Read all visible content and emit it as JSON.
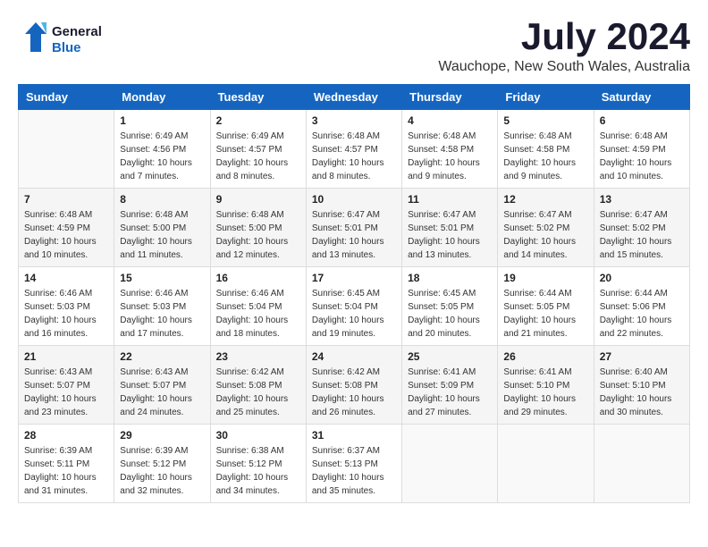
{
  "header": {
    "logo_general": "General",
    "logo_blue": "Blue",
    "month_title": "July 2024",
    "location": "Wauchope, New South Wales, Australia"
  },
  "calendar": {
    "days_of_week": [
      "Sunday",
      "Monday",
      "Tuesday",
      "Wednesday",
      "Thursday",
      "Friday",
      "Saturday"
    ],
    "weeks": [
      [
        {
          "day": "",
          "info": ""
        },
        {
          "day": "1",
          "info": "Sunrise: 6:49 AM\nSunset: 4:56 PM\nDaylight: 10 hours\nand 7 minutes."
        },
        {
          "day": "2",
          "info": "Sunrise: 6:49 AM\nSunset: 4:57 PM\nDaylight: 10 hours\nand 8 minutes."
        },
        {
          "day": "3",
          "info": "Sunrise: 6:48 AM\nSunset: 4:57 PM\nDaylight: 10 hours\nand 8 minutes."
        },
        {
          "day": "4",
          "info": "Sunrise: 6:48 AM\nSunset: 4:58 PM\nDaylight: 10 hours\nand 9 minutes."
        },
        {
          "day": "5",
          "info": "Sunrise: 6:48 AM\nSunset: 4:58 PM\nDaylight: 10 hours\nand 9 minutes."
        },
        {
          "day": "6",
          "info": "Sunrise: 6:48 AM\nSunset: 4:59 PM\nDaylight: 10 hours\nand 10 minutes."
        }
      ],
      [
        {
          "day": "7",
          "info": "Sunrise: 6:48 AM\nSunset: 4:59 PM\nDaylight: 10 hours\nand 10 minutes."
        },
        {
          "day": "8",
          "info": "Sunrise: 6:48 AM\nSunset: 5:00 PM\nDaylight: 10 hours\nand 11 minutes."
        },
        {
          "day": "9",
          "info": "Sunrise: 6:48 AM\nSunset: 5:00 PM\nDaylight: 10 hours\nand 12 minutes."
        },
        {
          "day": "10",
          "info": "Sunrise: 6:47 AM\nSunset: 5:01 PM\nDaylight: 10 hours\nand 13 minutes."
        },
        {
          "day": "11",
          "info": "Sunrise: 6:47 AM\nSunset: 5:01 PM\nDaylight: 10 hours\nand 13 minutes."
        },
        {
          "day": "12",
          "info": "Sunrise: 6:47 AM\nSunset: 5:02 PM\nDaylight: 10 hours\nand 14 minutes."
        },
        {
          "day": "13",
          "info": "Sunrise: 6:47 AM\nSunset: 5:02 PM\nDaylight: 10 hours\nand 15 minutes."
        }
      ],
      [
        {
          "day": "14",
          "info": "Sunrise: 6:46 AM\nSunset: 5:03 PM\nDaylight: 10 hours\nand 16 minutes."
        },
        {
          "day": "15",
          "info": "Sunrise: 6:46 AM\nSunset: 5:03 PM\nDaylight: 10 hours\nand 17 minutes."
        },
        {
          "day": "16",
          "info": "Sunrise: 6:46 AM\nSunset: 5:04 PM\nDaylight: 10 hours\nand 18 minutes."
        },
        {
          "day": "17",
          "info": "Sunrise: 6:45 AM\nSunset: 5:04 PM\nDaylight: 10 hours\nand 19 minutes."
        },
        {
          "day": "18",
          "info": "Sunrise: 6:45 AM\nSunset: 5:05 PM\nDaylight: 10 hours\nand 20 minutes."
        },
        {
          "day": "19",
          "info": "Sunrise: 6:44 AM\nSunset: 5:05 PM\nDaylight: 10 hours\nand 21 minutes."
        },
        {
          "day": "20",
          "info": "Sunrise: 6:44 AM\nSunset: 5:06 PM\nDaylight: 10 hours\nand 22 minutes."
        }
      ],
      [
        {
          "day": "21",
          "info": "Sunrise: 6:43 AM\nSunset: 5:07 PM\nDaylight: 10 hours\nand 23 minutes."
        },
        {
          "day": "22",
          "info": "Sunrise: 6:43 AM\nSunset: 5:07 PM\nDaylight: 10 hours\nand 24 minutes."
        },
        {
          "day": "23",
          "info": "Sunrise: 6:42 AM\nSunset: 5:08 PM\nDaylight: 10 hours\nand 25 minutes."
        },
        {
          "day": "24",
          "info": "Sunrise: 6:42 AM\nSunset: 5:08 PM\nDaylight: 10 hours\nand 26 minutes."
        },
        {
          "day": "25",
          "info": "Sunrise: 6:41 AM\nSunset: 5:09 PM\nDaylight: 10 hours\nand 27 minutes."
        },
        {
          "day": "26",
          "info": "Sunrise: 6:41 AM\nSunset: 5:10 PM\nDaylight: 10 hours\nand 29 minutes."
        },
        {
          "day": "27",
          "info": "Sunrise: 6:40 AM\nSunset: 5:10 PM\nDaylight: 10 hours\nand 30 minutes."
        }
      ],
      [
        {
          "day": "28",
          "info": "Sunrise: 6:39 AM\nSunset: 5:11 PM\nDaylight: 10 hours\nand 31 minutes."
        },
        {
          "day": "29",
          "info": "Sunrise: 6:39 AM\nSunset: 5:12 PM\nDaylight: 10 hours\nand 32 minutes."
        },
        {
          "day": "30",
          "info": "Sunrise: 6:38 AM\nSunset: 5:12 PM\nDaylight: 10 hours\nand 34 minutes."
        },
        {
          "day": "31",
          "info": "Sunrise: 6:37 AM\nSunset: 5:13 PM\nDaylight: 10 hours\nand 35 minutes."
        },
        {
          "day": "",
          "info": ""
        },
        {
          "day": "",
          "info": ""
        },
        {
          "day": "",
          "info": ""
        }
      ]
    ]
  }
}
